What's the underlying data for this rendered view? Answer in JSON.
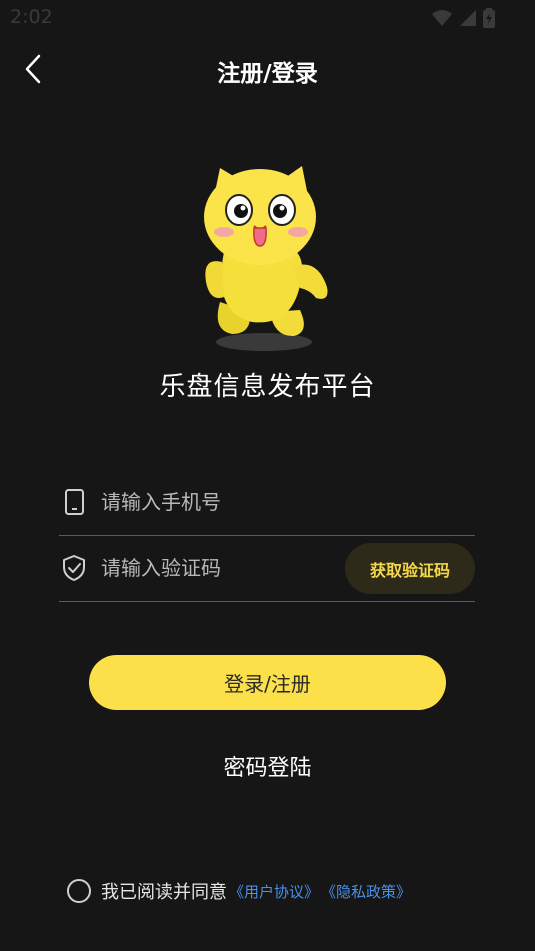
{
  "status_bar": {
    "time": "2:02",
    "icons": [
      "wifi-icon",
      "signal-icon",
      "battery-icon"
    ]
  },
  "nav": {
    "title": "注册/登录",
    "back_icon": "chevron-left-icon"
  },
  "app": {
    "name": "乐盘信息发布平台"
  },
  "form": {
    "phone": {
      "placeholder": "请输入手机号",
      "value": "",
      "icon": "phone-icon"
    },
    "code": {
      "placeholder": "请输入验证码",
      "value": "",
      "icon": "shield-check-icon"
    },
    "get_code_label": "获取验证码"
  },
  "actions": {
    "login_label": "登录/注册",
    "password_login_label": "密码登陆"
  },
  "agreement": {
    "text": "我已阅读并同意",
    "user_agreement": "《用户协议》",
    "privacy_policy": "《隐私政策》"
  },
  "colors": {
    "background": "#161616",
    "accent": "#fbe04a",
    "link": "#4a8fe8"
  }
}
